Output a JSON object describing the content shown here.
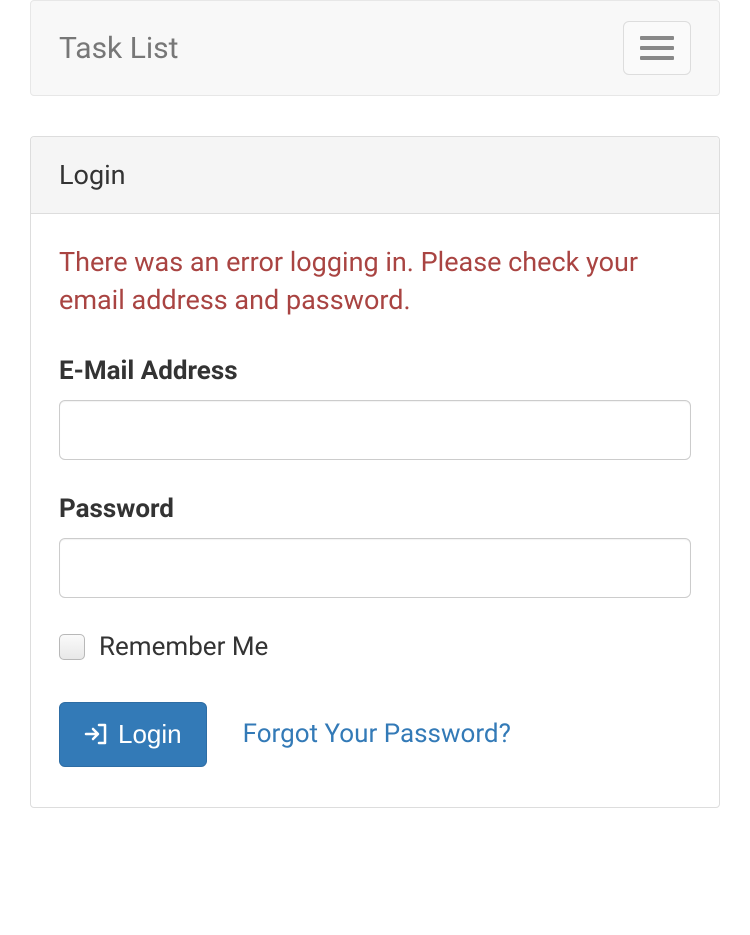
{
  "navbar": {
    "brand": "Task List"
  },
  "panel": {
    "heading": "Login",
    "error_message": "There was an error logging in. Please check your email address and password.",
    "email_label": "E-Mail Address",
    "email_value": "",
    "password_label": "Password",
    "password_value": "",
    "remember_label": "Remember Me",
    "login_button": "Login",
    "forgot_link": "Forgot Your Password?"
  }
}
